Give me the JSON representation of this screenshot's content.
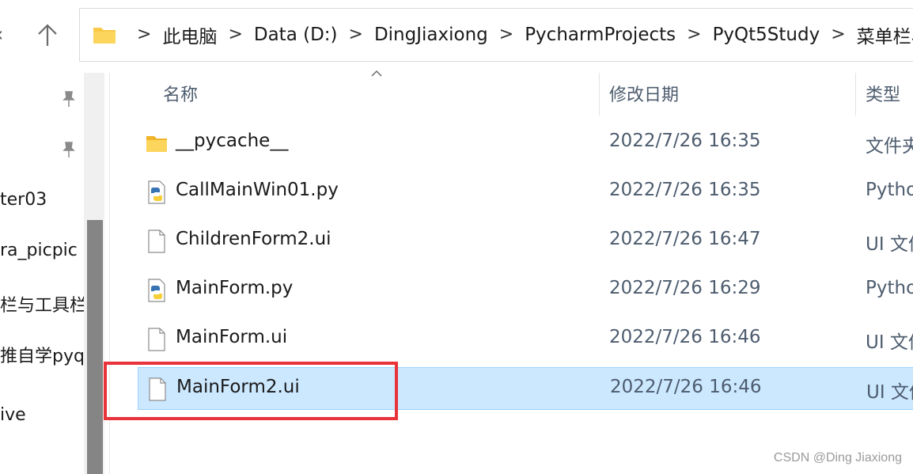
{
  "addressbar": {
    "crumbs": [
      "此电脑",
      "Data (D:)",
      "DingJiaxiong",
      "PycharmProjects",
      "PyQt5Study",
      "菜单栏与工具"
    ],
    "separator": ">"
  },
  "nav": {
    "items": [
      {
        "label": "ter03"
      },
      {
        "label": "ra_picpic"
      },
      {
        "label": "栏与工具栏"
      },
      {
        "label": "推自学pyq"
      },
      {
        "label": "ive"
      }
    ]
  },
  "columns": {
    "name": "名称",
    "date": "修改日期",
    "type": "类型"
  },
  "files": [
    {
      "name": "__pycache__",
      "date": "2022/7/26 16:35",
      "type": "文件夹",
      "icon": "folder-icon",
      "selected": false
    },
    {
      "name": "CallMainWin01.py",
      "date": "2022/7/26 16:35",
      "type": "Python",
      "icon": "python-file-icon",
      "selected": false
    },
    {
      "name": "ChildrenForm2.ui",
      "date": "2022/7/26 16:47",
      "type": "UI 文件",
      "icon": "file-icon",
      "selected": false
    },
    {
      "name": "MainForm.py",
      "date": "2022/7/26 16:29",
      "type": "Python",
      "icon": "python-file-icon",
      "selected": false
    },
    {
      "name": "MainForm.ui",
      "date": "2022/7/26 16:46",
      "type": "UI 文件",
      "icon": "file-icon",
      "selected": false
    },
    {
      "name": "MainForm2.ui",
      "date": "2022/7/26 16:46",
      "type": "UI 文件",
      "icon": "file-icon",
      "selected": true
    }
  ],
  "watermark": "CSDN @Ding Jiaxiong",
  "colors": {
    "selection": "#cce8ff",
    "highlight_box": "#e8333a",
    "folder": "#f8c847"
  }
}
